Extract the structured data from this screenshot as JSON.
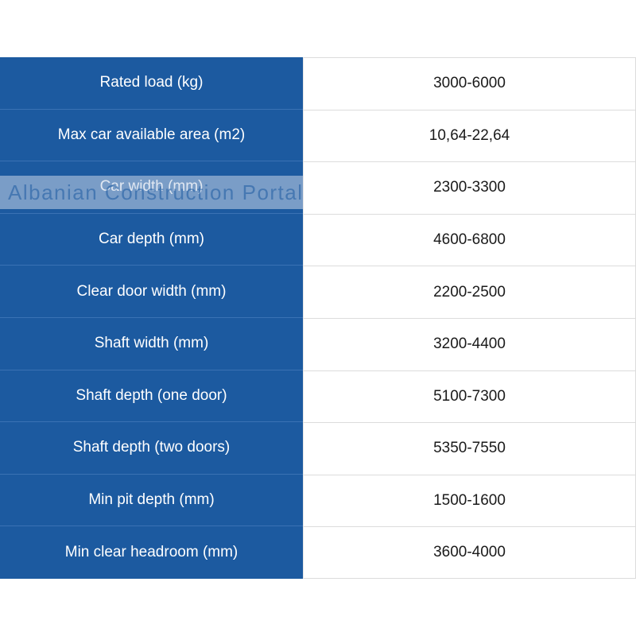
{
  "table": {
    "rows": [
      {
        "label": "Rated load (kg)",
        "value": "3000-6000"
      },
      {
        "label": "Max car available area (m2)",
        "value": "10,64-22,64"
      },
      {
        "label": "Car width (mm)",
        "value": "2300-3300"
      },
      {
        "label": "Car depth (mm)",
        "value": "4600-6800"
      },
      {
        "label": "Clear door width (mm)",
        "value": "2200-2500"
      },
      {
        "label": "Shaft width (mm)",
        "value": "3200-4400"
      },
      {
        "label": "Shaft depth (one door)",
        "value": "5100-7300"
      },
      {
        "label": "Shaft depth (two doors)",
        "value": "5350-7550"
      },
      {
        "label": "Min pit depth (mm)",
        "value": "1500-1600"
      },
      {
        "label": "Min clear headroom (mm)",
        "value": "3600-4000"
      }
    ]
  },
  "watermark": {
    "text": "Albanian Construction Portal"
  },
  "colors": {
    "label_background": "#1c5aa0",
    "label_text": "#ffffff",
    "value_text": "#1a1a1a"
  }
}
